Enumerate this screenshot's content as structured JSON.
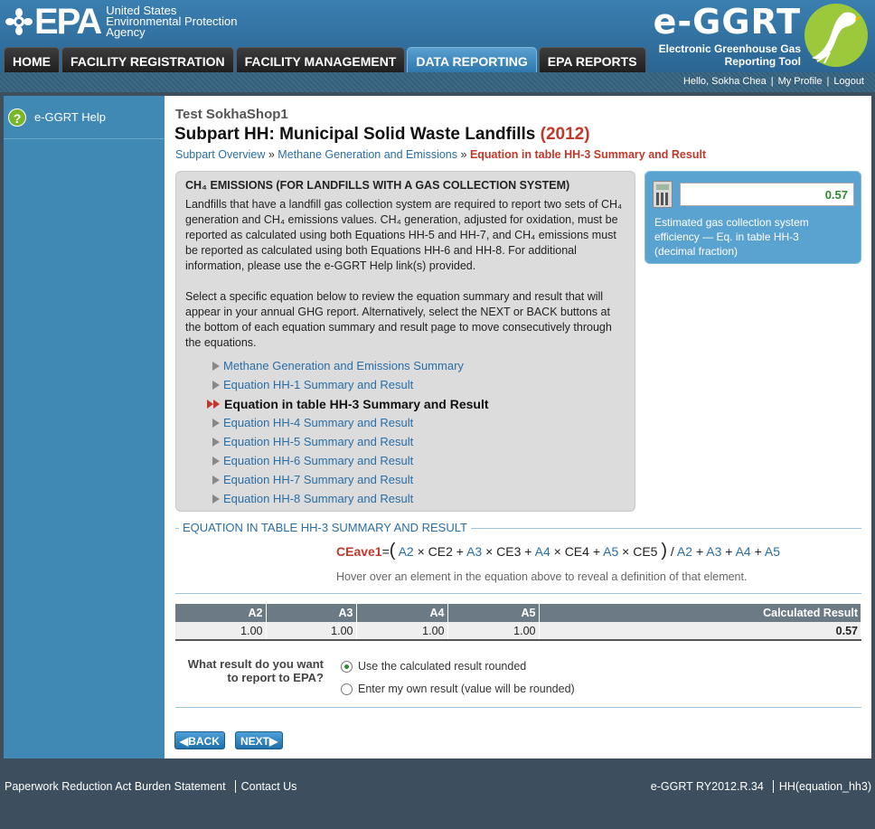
{
  "header": {
    "agency_abbr": "EPA",
    "agency_line1": "United States",
    "agency_line2": "Environmental Protection",
    "agency_line3": "Agency",
    "app_name": "e-GGRT",
    "app_sub1": "Electronic Greenhouse Gas",
    "app_sub2": "Reporting Tool"
  },
  "nav": {
    "tabs": [
      {
        "label": "HOME",
        "active": false
      },
      {
        "label": "FACILITY REGISTRATION",
        "active": false
      },
      {
        "label": "FACILITY MANAGEMENT",
        "active": false
      },
      {
        "label": "DATA REPORTING",
        "active": true
      },
      {
        "label": "EPA REPORTS",
        "active": false
      }
    ]
  },
  "userbar": {
    "greeting": "Hello, Sokha Chea",
    "profile": "My Profile",
    "logout": "Logout"
  },
  "sidebar": {
    "help_label": "e-GGRT Help",
    "help_glyph": "?"
  },
  "main": {
    "facility": "Test SokhaShop1",
    "title": "Subpart HH: Municipal Solid Waste Landfills",
    "year": "(2012)",
    "breadcrumb": {
      "item1": "Subpart Overview",
      "item2": "Methane Generation and Emissions",
      "current": "Equation in table HH-3 Summary and Result",
      "sep": "»"
    },
    "info": {
      "heading": "CH₄ EMISSIONS (FOR LANDFILLS WITH A GAS COLLECTION SYSTEM)",
      "para1": "Landfills that have a landfill gas collection system are required to report two sets of CH₄ generation and CH₄ emissions values. CH₄ generation, adjusted for oxidation, must be reported as calculated using both Equations HH-5 and HH-7, and CH₄ emissions must be reported as calculated using both Equations HH-6 and HH-8. For additional information, please use the e-GGRT Help link(s) provided.",
      "para2": "Select a specific equation below to review the equation summary and result that will appear in your annual GHG report. Alternatively, select the NEXT or BACK buttons at the bottom of each equation summary and result page to move consecutively through the equations.",
      "equations": [
        {
          "label": "Methane Generation and Emissions Summary",
          "current": false
        },
        {
          "label": "Equation HH-1 Summary and Result",
          "current": false
        },
        {
          "label": "Equation in table HH-3 Summary and Result",
          "current": true
        },
        {
          "label": "Equation HH-4 Summary and Result",
          "current": false
        },
        {
          "label": "Equation HH-5 Summary and Result",
          "current": false
        },
        {
          "label": "Equation HH-6 Summary and Result",
          "current": false
        },
        {
          "label": "Equation HH-7 Summary and Result",
          "current": false
        },
        {
          "label": "Equation HH-8 Summary and Result",
          "current": false
        }
      ]
    },
    "calc": {
      "value": "0.57",
      "label": "Estimated gas collection system efficiency — Eq. in table HH-3 (decimal fraction)"
    },
    "section_title": "EQUATION IN TABLE HH-3 SUMMARY AND RESULT",
    "equation": {
      "lhs": "CEave1",
      "eq": "=",
      "open": "(",
      "close": ")",
      "terms": [
        "A2",
        "× CE2 +",
        "A3",
        "× CE3 +",
        "A4",
        "× CE4 +",
        "A5",
        "× CE5"
      ],
      "denominator": [
        "A2",
        "+",
        "A3",
        "+",
        "A4",
        "+",
        "A5"
      ],
      "slash": "/"
    },
    "hint": "Hover over an element in the equation above to reveal a definition of that element.",
    "table": {
      "headers": [
        "A2",
        "A3",
        "A4",
        "A5",
        "Calculated Result"
      ],
      "values": [
        "1.00",
        "1.00",
        "1.00",
        "1.00",
        "0.57"
      ]
    },
    "question": "What result do you want to report to EPA?",
    "options": [
      {
        "label": "Use the calculated result rounded",
        "selected": true
      },
      {
        "label": "Enter my own result (value will be rounded)",
        "selected": false
      }
    ],
    "back_label": "BACK",
    "next_label": "NEXT"
  },
  "footer": {
    "paperwork": "Paperwork Reduction Act Burden Statement",
    "contact": "Contact Us",
    "version": "e-GGRT RY2012.R.34",
    "page_id": "HH(equation_hh3)"
  },
  "colors": {
    "accent_blue": "#2a6ea6",
    "highlight_red": "#c0392b",
    "result_green": "#2e8b2e"
  }
}
